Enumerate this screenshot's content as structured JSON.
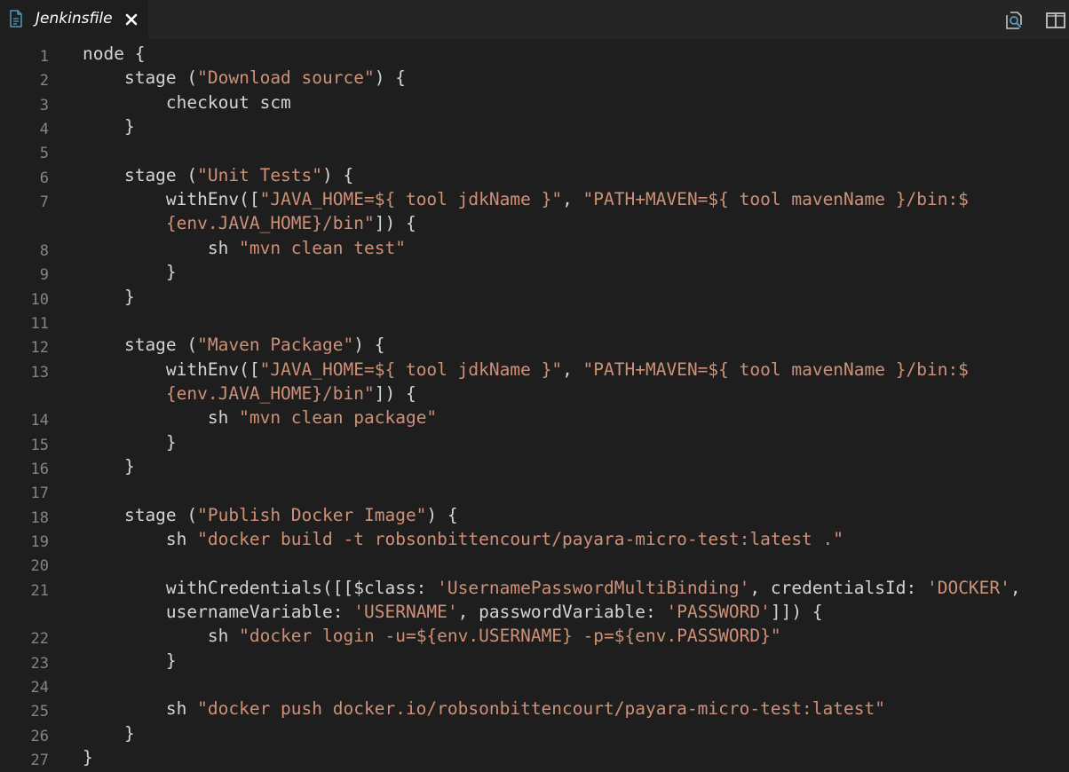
{
  "tab": {
    "title": "Jenkinsfile",
    "file_icon": "file-icon",
    "close_icon": "close-icon"
  },
  "actions": [
    {
      "name": "open-preview-icon"
    },
    {
      "name": "split-editor-icon"
    }
  ],
  "colors": {
    "background": "#1e1e1e",
    "tabbar": "#252526",
    "text": "#d4d4d4",
    "string": "#ce9178",
    "line_number": "#858585",
    "icon": "#c5c5c5",
    "file_icon": "#519aba"
  },
  "code": {
    "lines": [
      {
        "n": "1",
        "segs": [
          {
            "t": "node {",
            "k": "p"
          }
        ]
      },
      {
        "n": "2",
        "segs": [
          {
            "t": "    stage (",
            "k": "p"
          },
          {
            "t": "\"Download source\"",
            "k": "s"
          },
          {
            "t": ") {",
            "k": "p"
          }
        ]
      },
      {
        "n": "3",
        "segs": [
          {
            "t": "        checkout scm",
            "k": "p"
          }
        ]
      },
      {
        "n": "4",
        "segs": [
          {
            "t": "    }",
            "k": "p"
          }
        ]
      },
      {
        "n": "5",
        "segs": []
      },
      {
        "n": "6",
        "segs": [
          {
            "t": "    stage (",
            "k": "p"
          },
          {
            "t": "\"Unit Tests\"",
            "k": "s"
          },
          {
            "t": ") {",
            "k": "p"
          }
        ]
      },
      {
        "n": "7",
        "segs": [
          {
            "t": "        withEnv([",
            "k": "p"
          },
          {
            "t": "\"JAVA_HOME=${ tool jdkName }\"",
            "k": "s"
          },
          {
            "t": ", ",
            "k": "p"
          },
          {
            "t": "\"PATH+MAVEN=${ tool mavenName }/bin:$",
            "k": "s"
          }
        ]
      },
      {
        "n": "",
        "segs": [
          {
            "t": "        ",
            "k": "p"
          },
          {
            "t": "{env.JAVA_HOME}/bin\"",
            "k": "s"
          },
          {
            "t": "]) {",
            "k": "p"
          }
        ]
      },
      {
        "n": "8",
        "segs": [
          {
            "t": "            sh ",
            "k": "p"
          },
          {
            "t": "\"mvn clean test\"",
            "k": "s"
          }
        ]
      },
      {
        "n": "9",
        "segs": [
          {
            "t": "        }",
            "k": "p"
          }
        ]
      },
      {
        "n": "10",
        "segs": [
          {
            "t": "    }",
            "k": "p"
          }
        ]
      },
      {
        "n": "11",
        "segs": []
      },
      {
        "n": "12",
        "segs": [
          {
            "t": "    stage (",
            "k": "p"
          },
          {
            "t": "\"Maven Package\"",
            "k": "s"
          },
          {
            "t": ") {",
            "k": "p"
          }
        ]
      },
      {
        "n": "13",
        "segs": [
          {
            "t": "        withEnv([",
            "k": "p"
          },
          {
            "t": "\"JAVA_HOME=${ tool jdkName }\"",
            "k": "s"
          },
          {
            "t": ", ",
            "k": "p"
          },
          {
            "t": "\"PATH+MAVEN=${ tool mavenName }/bin:$",
            "k": "s"
          }
        ]
      },
      {
        "n": "",
        "segs": [
          {
            "t": "        ",
            "k": "p"
          },
          {
            "t": "{env.JAVA_HOME}/bin\"",
            "k": "s"
          },
          {
            "t": "]) {",
            "k": "p"
          }
        ]
      },
      {
        "n": "14",
        "segs": [
          {
            "t": "            sh ",
            "k": "p"
          },
          {
            "t": "\"mvn clean package\"",
            "k": "s"
          }
        ]
      },
      {
        "n": "15",
        "segs": [
          {
            "t": "        }",
            "k": "p"
          }
        ]
      },
      {
        "n": "16",
        "segs": [
          {
            "t": "    }",
            "k": "p"
          }
        ]
      },
      {
        "n": "17",
        "segs": []
      },
      {
        "n": "18",
        "segs": [
          {
            "t": "    stage (",
            "k": "p"
          },
          {
            "t": "\"Publish Docker Image\"",
            "k": "s"
          },
          {
            "t": ") {",
            "k": "p"
          }
        ]
      },
      {
        "n": "19",
        "segs": [
          {
            "t": "        sh ",
            "k": "p"
          },
          {
            "t": "\"docker build -t robsonbittencourt/payara-micro-test:latest .\"",
            "k": "s"
          }
        ]
      },
      {
        "n": "20",
        "segs": []
      },
      {
        "n": "21",
        "segs": [
          {
            "t": "        withCredentials([[$class: ",
            "k": "p"
          },
          {
            "t": "'UsernamePasswordMultiBinding'",
            "k": "s"
          },
          {
            "t": ", credentialsId: ",
            "k": "p"
          },
          {
            "t": "'DOCKER'",
            "k": "s"
          },
          {
            "t": ",",
            "k": "p"
          }
        ]
      },
      {
        "n": "",
        "segs": [
          {
            "t": "        usernameVariable: ",
            "k": "p"
          },
          {
            "t": "'USERNAME'",
            "k": "s"
          },
          {
            "t": ", passwordVariable: ",
            "k": "p"
          },
          {
            "t": "'PASSWORD'",
            "k": "s"
          },
          {
            "t": "]]) {",
            "k": "p"
          }
        ]
      },
      {
        "n": "22",
        "segs": [
          {
            "t": "            sh ",
            "k": "p"
          },
          {
            "t": "\"docker login -u=${env.USERNAME} -p=${env.PASSWORD}\"",
            "k": "s"
          }
        ]
      },
      {
        "n": "23",
        "segs": [
          {
            "t": "        }",
            "k": "p"
          }
        ]
      },
      {
        "n": "24",
        "segs": []
      },
      {
        "n": "25",
        "segs": [
          {
            "t": "        sh ",
            "k": "p"
          },
          {
            "t": "\"docker push docker.io/robsonbittencourt/payara-micro-test:latest\"",
            "k": "s"
          }
        ]
      },
      {
        "n": "26",
        "segs": [
          {
            "t": "    }",
            "k": "p"
          }
        ]
      },
      {
        "n": "27",
        "segs": [
          {
            "t": "}",
            "k": "p"
          }
        ]
      }
    ]
  }
}
